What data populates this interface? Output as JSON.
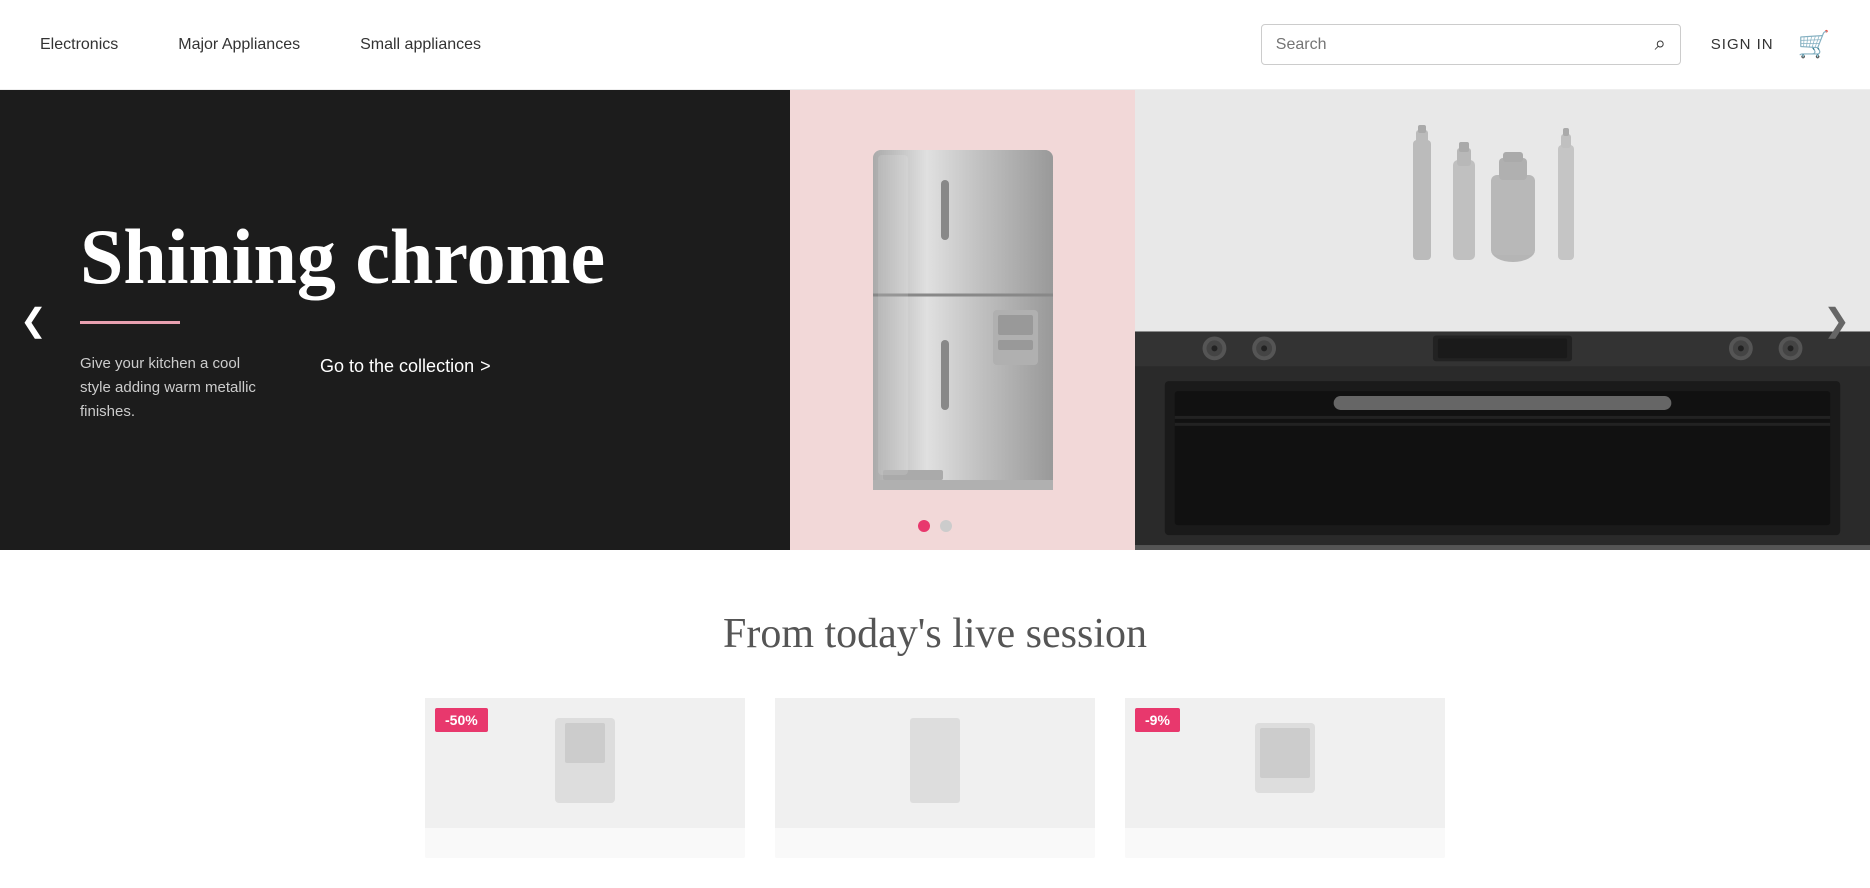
{
  "header": {
    "nav": [
      {
        "label": "Electronics",
        "id": "electronics"
      },
      {
        "label": "Major Appliances",
        "id": "major-appliances"
      },
      {
        "label": "Small appliances",
        "id": "small-appliances"
      }
    ],
    "search": {
      "placeholder": "Search"
    },
    "sign_in_label": "SIGN IN",
    "cart_icon": "🛒"
  },
  "hero": {
    "title": "Shining chrome",
    "divider_color": "#e8a0b0",
    "description": "Give your kitchen a cool style adding warm metallic finishes.",
    "cta_label": "Go to the collection",
    "cta_arrow": ">",
    "dots": [
      {
        "active": true
      },
      {
        "active": false
      }
    ],
    "arrow_left": "❮",
    "arrow_right": "❯",
    "panel_dark_bg": "#1c1c1c",
    "panel_pink_bg": "#f2d8d8",
    "panel_gray_bg": "#e0e0e0"
  },
  "live_session": {
    "title": "From today's live session",
    "products": [
      {
        "badge": "-50%"
      },
      {},
      {
        "badge": "-9%"
      }
    ]
  }
}
